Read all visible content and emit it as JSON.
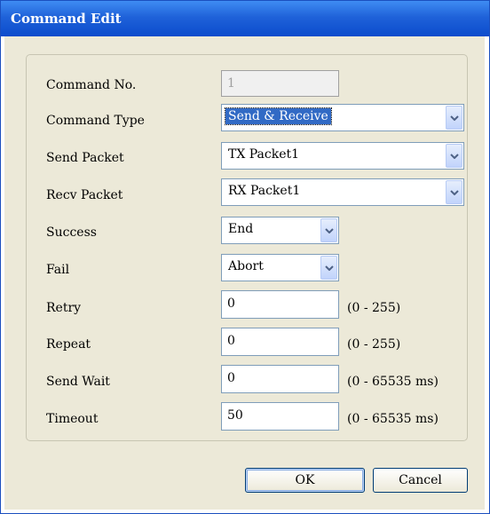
{
  "window": {
    "title": "Command Edit"
  },
  "form": {
    "command_no": {
      "label": "Command No.",
      "value": "1"
    },
    "command_type": {
      "label": "Command Type",
      "value": "Send & Receive"
    },
    "send_packet": {
      "label": "Send Packet",
      "value": "TX Packet1"
    },
    "recv_packet": {
      "label": "Recv Packet",
      "value": "RX Packet1"
    },
    "success": {
      "label": "Success",
      "value": "End"
    },
    "fail": {
      "label": "Fail",
      "value": "Abort"
    },
    "retry": {
      "label": "Retry",
      "value": "0",
      "range": "(0 - 255)"
    },
    "repeat": {
      "label": "Repeat",
      "value": "0",
      "range": "(0 - 255)"
    },
    "send_wait": {
      "label": "Send Wait",
      "value": "0",
      "range": "(0 - 65535 ms)"
    },
    "timeout": {
      "label": "Timeout",
      "value": "50",
      "range": "(0 - 65535 ms)"
    }
  },
  "buttons": {
    "ok": "OK",
    "cancel": "Cancel"
  },
  "colors": {
    "titlebar": "#0b4ccc",
    "dialog_bg": "#ece9d8",
    "selection": "#316ac5"
  },
  "icons": {
    "dropdown": "chevron-down-icon"
  }
}
